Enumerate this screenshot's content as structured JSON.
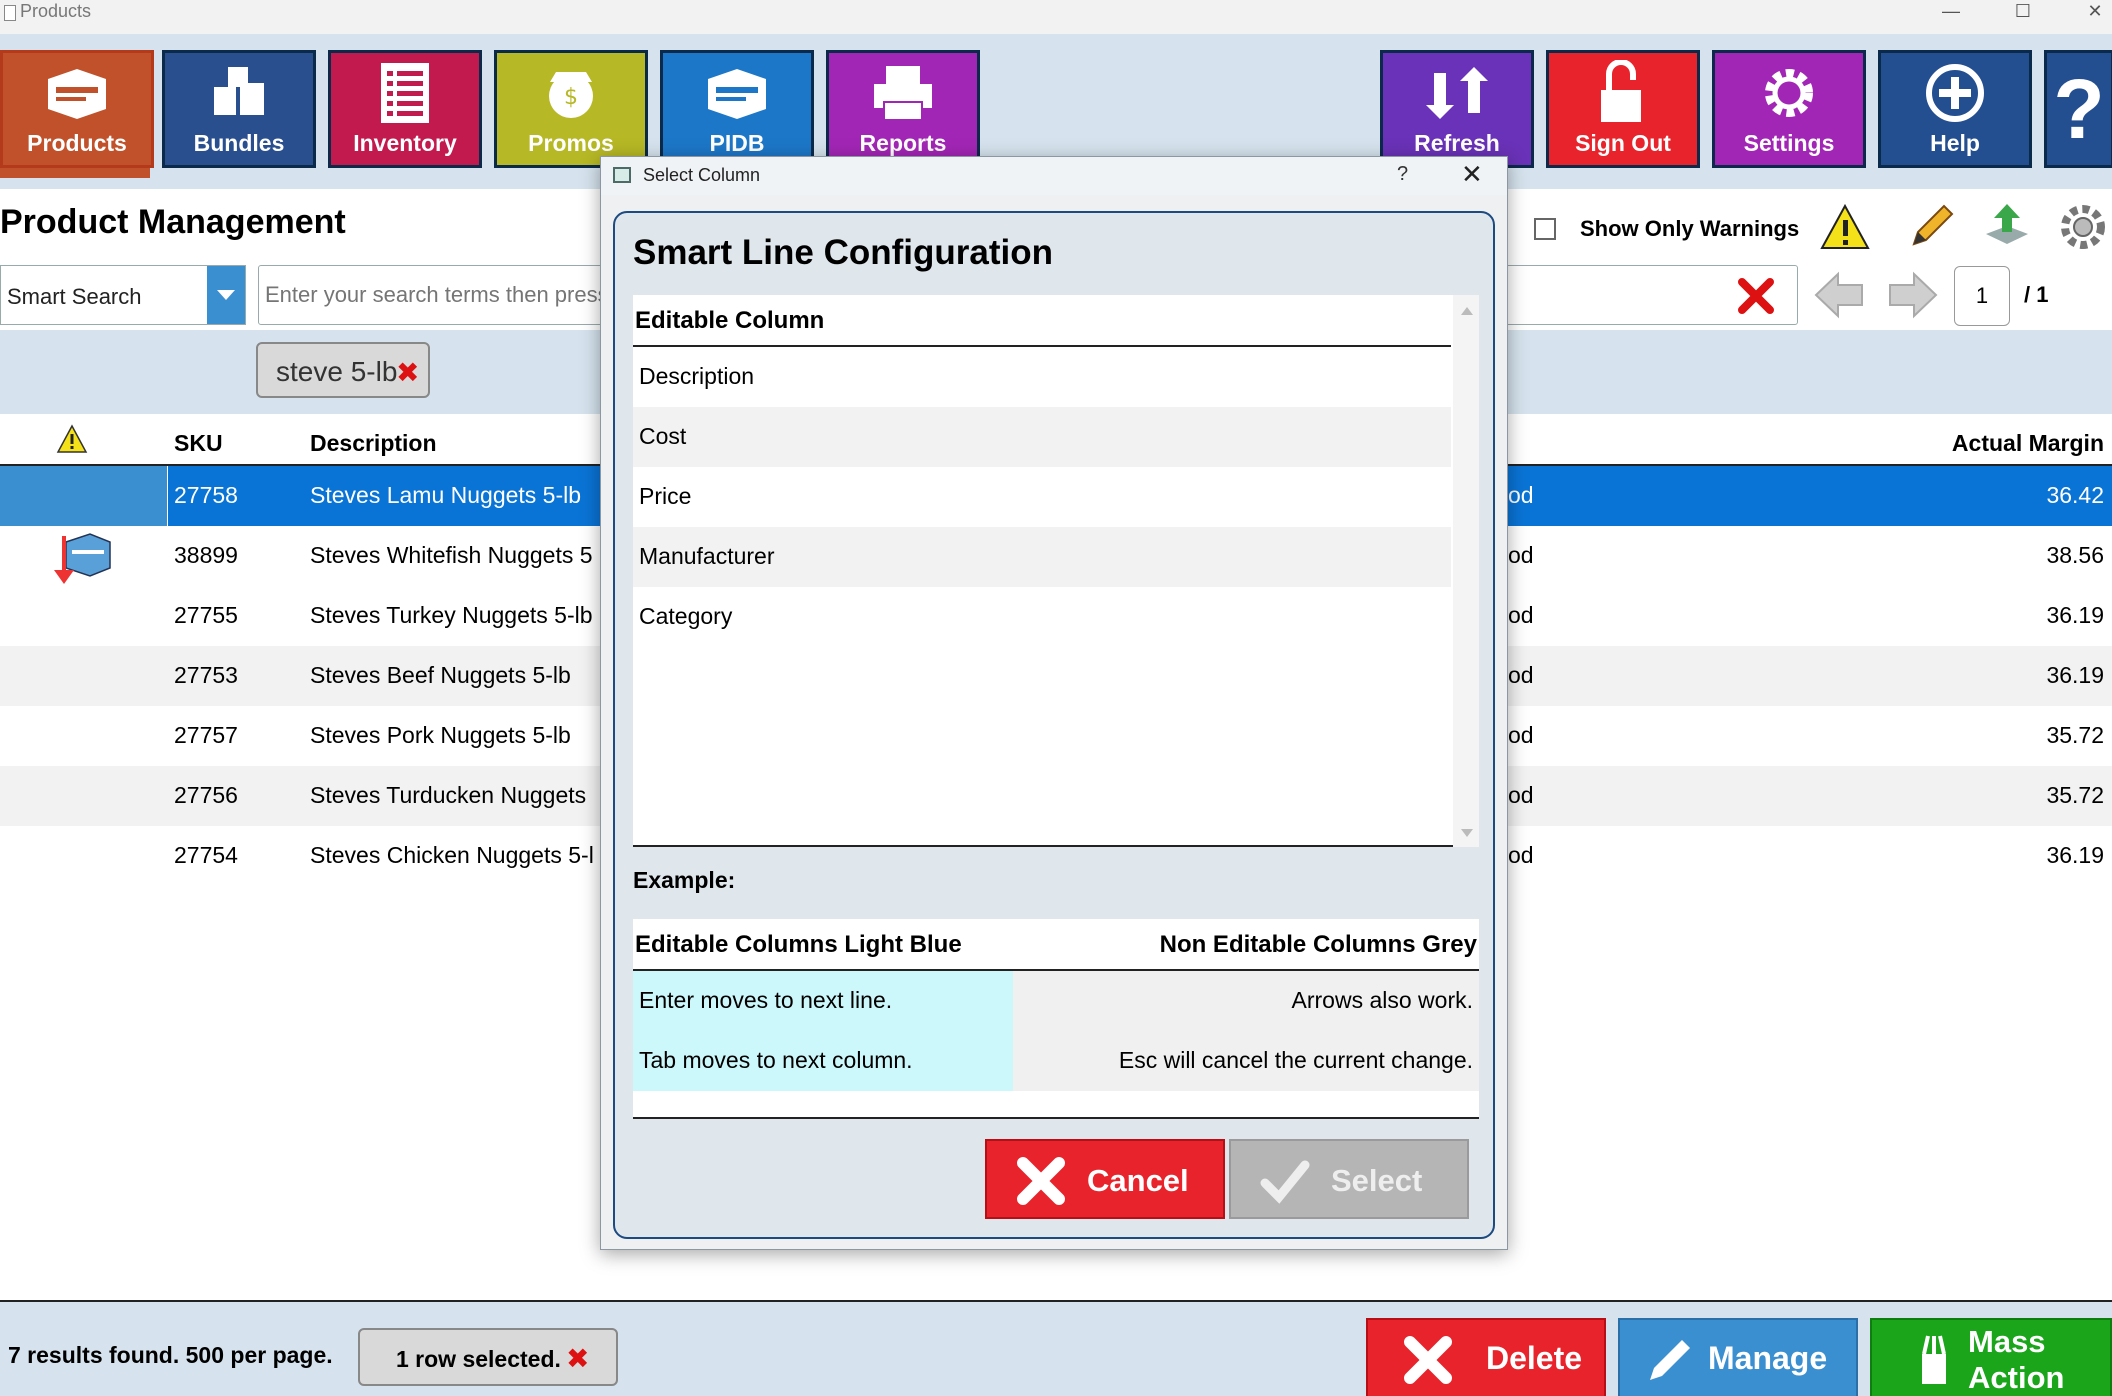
{
  "window": {
    "title": "Products",
    "controls": [
      "—",
      "☐",
      "✕"
    ]
  },
  "ribbon": {
    "tabs": [
      {
        "label": "Products",
        "color": "#c0512a"
      },
      {
        "label": "Bundles",
        "color": "#2a4f8f"
      },
      {
        "label": "Inventory",
        "color": "#c21a4e"
      },
      {
        "label": "Promos",
        "color": "#b7b825"
      },
      {
        "label": "PIDB",
        "color": "#1d77c8"
      },
      {
        "label": "Reports",
        "color": "#a226b5"
      }
    ],
    "actions": [
      {
        "label": "Refresh",
        "color": "#6a32b8"
      },
      {
        "label": "Sign Out",
        "color": "#e8232b"
      },
      {
        "label": "Settings",
        "color": "#a226b5"
      },
      {
        "label": "Help",
        "color": "#234f91"
      },
      {
        "label": "?",
        "color": "#234f91"
      }
    ]
  },
  "header": {
    "title": "Product Management",
    "show_only_warnings": "Show Only Warnings",
    "search_mode": "Smart Search",
    "search_placeholder": "Enter your search terms then press",
    "page_current": "1",
    "page_total": "/  1"
  },
  "filter_chip": {
    "text": "steve 5-lb",
    "remove": "✖"
  },
  "grid": {
    "columns": {
      "sku": "SKU",
      "description": "Description",
      "actual_margin": "Actual Margin"
    },
    "rows": [
      {
        "sku": "27758",
        "description": "Steves Lamu Nuggets 5-lb",
        "partial": "od",
        "margin": "36.42",
        "selected": true
      },
      {
        "sku": "38899",
        "description": "Steves Whitefish Nuggets 5",
        "partial": "od",
        "margin": "38.56"
      },
      {
        "sku": "27755",
        "description": "Steves Turkey Nuggets 5-lb",
        "partial": "od",
        "margin": "36.19"
      },
      {
        "sku": "27753",
        "description": "Steves Beef Nuggets 5-lb",
        "partial": "od",
        "margin": "36.19"
      },
      {
        "sku": "27757",
        "description": "Steves Pork Nuggets 5-lb",
        "partial": "od",
        "margin": "35.72"
      },
      {
        "sku": "27756",
        "description": "Steves Turducken Nuggets",
        "partial": "od",
        "margin": "35.72"
      },
      {
        "sku": "27754",
        "description": "Steves Chicken Nuggets 5-l",
        "partial": "od",
        "margin": "36.19"
      }
    ]
  },
  "footer": {
    "results": "7 results found.  500 per page.",
    "row_selected": "1 row selected.",
    "delete": "Delete",
    "manage": "Manage",
    "mass_action": "Mass\nAction",
    "mass_action_line1": "Mass",
    "mass_action_line2": "Action"
  },
  "dialog": {
    "window_title": "Select Column",
    "help": "?",
    "close": "✕",
    "heading": "Smart Line Configuration",
    "list_header": "Editable Column",
    "items": [
      "Description",
      "Cost",
      "Price",
      "Manufacturer",
      "Category"
    ],
    "example_label": "Example:",
    "example": {
      "left_header": "Editable Columns Light Blue",
      "right_header": "Non Editable Columns Grey",
      "rows": [
        {
          "left": "Enter moves to next line.",
          "right": "Arrows also work."
        },
        {
          "left": "Tab moves to next column.",
          "right": "Esc will cancel the current change."
        }
      ]
    },
    "cancel": "Cancel",
    "select": "Select"
  }
}
